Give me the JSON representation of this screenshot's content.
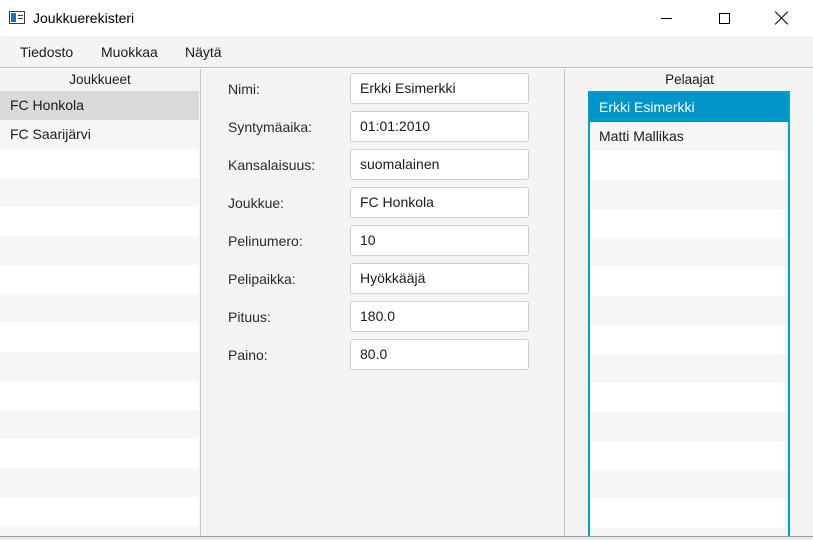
{
  "window": {
    "title": "Joukkuerekisteri"
  },
  "menu": {
    "items": [
      "Tiedosto",
      "Muokkaa",
      "Näytä"
    ]
  },
  "teams_panel": {
    "header": "Joukkueet",
    "items": [
      "FC Honkola",
      "FC Saarijärvi"
    ],
    "selected_index": 0
  },
  "player_form": {
    "fields": [
      {
        "label": "Nimi:",
        "value": "Erkki Esimerkki"
      },
      {
        "label": "Syntymäaika:",
        "value": "01:01:2010"
      },
      {
        "label": "Kansalaisuus:",
        "value": "suomalainen"
      },
      {
        "label": "Joukkue:",
        "value": "FC Honkola"
      },
      {
        "label": "Pelinumero:",
        "value": "10"
      },
      {
        "label": "Pelipaikka:",
        "value": "Hyökkääjä"
      },
      {
        "label": "Pituus:",
        "value": "180.0"
      },
      {
        "label": "Paino:",
        "value": "80.0"
      }
    ]
  },
  "players_panel": {
    "header": "Pelaajat",
    "items": [
      "Erkki Esimerkki",
      "Matti Mallikas"
    ],
    "selected_index": 0
  },
  "colors": {
    "selection_blue": "#0096c9",
    "focus_border": "#039ed3",
    "selection_grey": "#d9d9d9"
  }
}
